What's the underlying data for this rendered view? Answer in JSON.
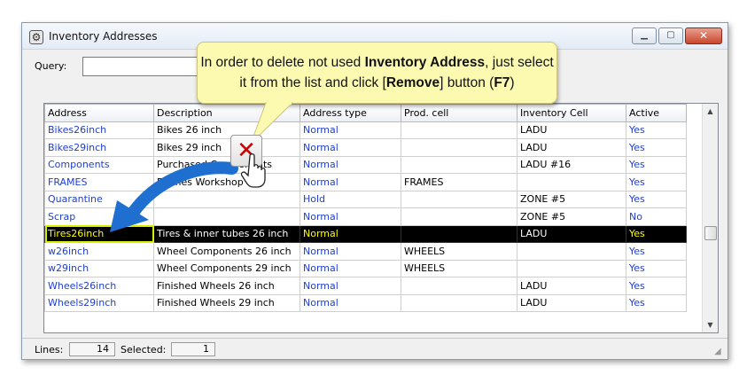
{
  "window": {
    "title": "Inventory Addresses",
    "icon": "inventory-app-icon",
    "minimize_icon": "minimize-icon",
    "maximize_icon": "maximize-icon",
    "close_icon": "close-icon"
  },
  "query": {
    "label": "Query:",
    "value": ""
  },
  "table": {
    "columns": [
      "Address",
      "Description",
      "Address type",
      "Prod. cell",
      "Inventory Cell",
      "Active"
    ],
    "rows": [
      [
        "Bikes26inch",
        "Bikes 26 inch",
        "Normal",
        "",
        "LADU",
        "Yes"
      ],
      [
        "Bikes29inch",
        "Bikes 29 inch",
        "Normal",
        "",
        "LADU",
        "Yes"
      ],
      [
        "Components",
        "Purchased Components",
        "Normal",
        "",
        "LADU #16",
        "Yes"
      ],
      [
        "FRAMES",
        "Frames Workshop",
        "Normal",
        "FRAMES",
        "",
        "Yes"
      ],
      [
        "Quarantine",
        "",
        "Hold",
        "",
        "ZONE #5",
        "Yes"
      ],
      [
        "Scrap",
        "",
        "Normal",
        "",
        "ZONE #5",
        "No"
      ],
      [
        "Tires26inch",
        "Tires & inner tubes 26 inch",
        "Normal",
        "",
        "LADU",
        "Yes"
      ],
      [
        "w26inch",
        "Wheel Components 26 inch",
        "Normal",
        "WHEELS",
        "",
        "Yes"
      ],
      [
        "w29inch",
        "Wheel Components 29 inch",
        "Normal",
        "WHEELS",
        "",
        "Yes"
      ],
      [
        "Wheels26inch",
        "Finished Wheels 26 inch",
        "Normal",
        "",
        "LADU",
        "Yes"
      ],
      [
        "Wheels29inch",
        "Finished Wheels 29 inch",
        "Normal",
        "",
        "LADU",
        "Yes"
      ]
    ],
    "selected_row": 6
  },
  "status": {
    "lines_label": "Lines:",
    "lines_value": "14",
    "selected_label": "Selected:",
    "selected_value": "1"
  },
  "callout": {
    "part1": "In order to delete not used ",
    "bold1": "Inventory Address",
    "part2": ", just select it from the list and click [",
    "bold2": "Remove",
    "part3": "] button (",
    "bold3": "F7",
    "part4": ")"
  },
  "colors": {
    "link_blue": "#1f3fd1",
    "selection_bg": "#000000",
    "selection_fg": "#ffff00",
    "callout_bg": "#fbfab0",
    "arrow_blue": "#1e6fd0"
  }
}
